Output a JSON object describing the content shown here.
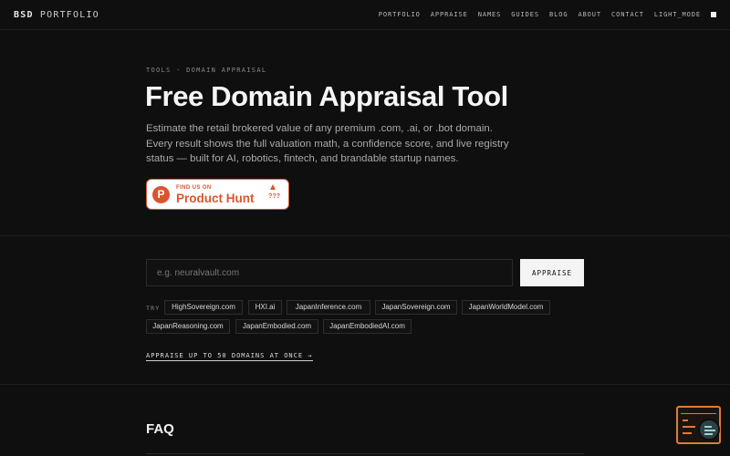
{
  "header": {
    "logo_bold": "BSD",
    "logo_rest": "PORTFOLIO",
    "nav": [
      "PORTFOLIO",
      "APPRAISE",
      "NAMES",
      "GUIDES",
      "BLOG",
      "ABOUT",
      "CONTACT",
      "LIGHT_MODE"
    ]
  },
  "hero": {
    "breadcrumb": "TOOLS · DOMAIN APPRAISAL",
    "title": "Free Domain Appraisal Tool",
    "description": "Estimate the retail brokered value of any premium .com, .ai, or .bot domain. Every result shows the full valuation math, a confidence score, and live registry status — built for AI, robotics, fintech, and brandable startup names.",
    "badge": {
      "small": "FIND US ON",
      "big": "Product Hunt",
      "count": "???",
      "logo_letter": "P",
      "color": "#da552f"
    }
  },
  "appraise": {
    "placeholder": "e.g. neuralvault.com",
    "button": "APPRAISE",
    "try_label": "TRY",
    "suggestions": [
      "HighSovereign.com",
      "HXI.ai",
      "JapanInference.com",
      "JapanSovereign.com",
      "JapanWorldModel.com",
      "JapanReasoning.com",
      "JapanEmbodied.com",
      "JapanEmbodiedAI.com"
    ],
    "bulk_link": "APPRAISE UP TO 50 DOMAINS AT ONCE →"
  },
  "faq": {
    "title": "FAQ"
  },
  "widget": {
    "icon": "chat-search-icon",
    "accent": "#e07a3c"
  }
}
